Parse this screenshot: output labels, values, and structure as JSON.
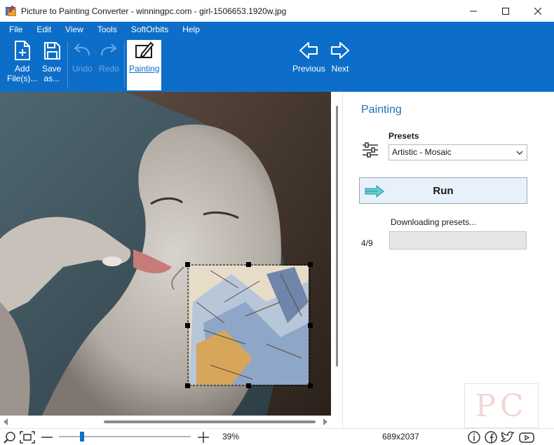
{
  "window": {
    "title": "Picture to Painting Converter - winningpc.com - girl-1506653.1920w.jpg"
  },
  "menu": [
    "File",
    "Edit",
    "View",
    "Tools",
    "SoftOrbits",
    "Help"
  ],
  "toolbar": {
    "add_files_line1": "Add",
    "add_files_line2": "File(s)...",
    "save_as_line1": "Save",
    "save_as_line2": "as...",
    "undo": "Undo",
    "redo": "Redo",
    "painting": "Painting",
    "previous": "Previous",
    "next": "Next"
  },
  "panel": {
    "title": "Painting",
    "presets_label": "Presets",
    "preset_selected": "Artistic - Mosaic",
    "run_label": "Run",
    "download_text": "Downloading presets...",
    "progress_count": "4/9",
    "progress_fraction": 0.0
  },
  "watermark": "PC",
  "status": {
    "zoom": "39%",
    "dimensions": "689x2037",
    "zoom_fraction": 0.16
  },
  "colors": {
    "accent": "#0d6ec9",
    "panel_title": "#1f6fb8",
    "run_bg": "#e8f1fa"
  },
  "icons": [
    "app-icon",
    "minimize-icon",
    "maximize-icon",
    "close-icon",
    "add-file-icon",
    "save-icon",
    "undo-icon",
    "redo-icon",
    "painting-icon",
    "previous-arrow-icon",
    "next-arrow-icon",
    "presets-sliders-icon",
    "chevron-down-icon",
    "run-arrow-icon",
    "zoom-icon",
    "fit-icon",
    "minus-icon",
    "plus-icon",
    "info-icon",
    "facebook-icon",
    "twitter-icon",
    "youtube-icon"
  ]
}
